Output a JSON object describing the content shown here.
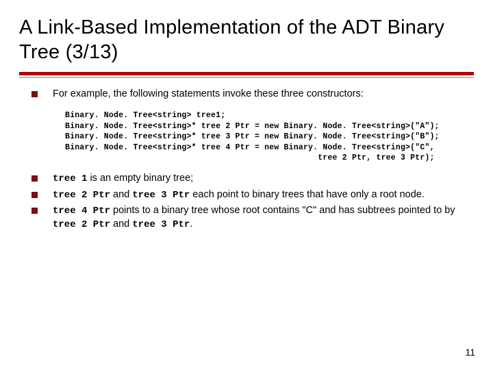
{
  "title": "A Link-Based Implementation of the ADT Binary Tree (3/13)",
  "bullets": {
    "intro": "For example, the following statements invoke these three constructors:",
    "b2_code1": "tree 1",
    "b2_rest": " is an empty binary tree;",
    "b3_code1": "tree 2 Ptr",
    "b3_mid": " and ",
    "b3_code2": "tree 3 Ptr",
    "b3_rest": " each point to binary trees that have only a root node.",
    "b4_code1": "tree 4 Ptr",
    "b4_mid": " points to a binary tree whose root contains \"C\" and has subtrees pointed to by ",
    "b4_code2": "tree 2 Ptr",
    "b4_and": " and ",
    "b4_code3": "tree 3 Ptr",
    "b4_end": "."
  },
  "code": "Binary. Node. Tree<string> tree1;\nBinary. Node. Tree<string>* tree 2 Ptr = new Binary. Node. Tree<string>(\"A\");\nBinary. Node. Tree<string>* tree 3 Ptr = new Binary. Node. Tree<string>(\"B\");\nBinary. Node. Tree<string>* tree 4 Ptr = new Binary. Node. Tree<string>(\"C\",\n                                                    tree 2 Ptr, tree 3 Ptr);",
  "page_number": "11"
}
